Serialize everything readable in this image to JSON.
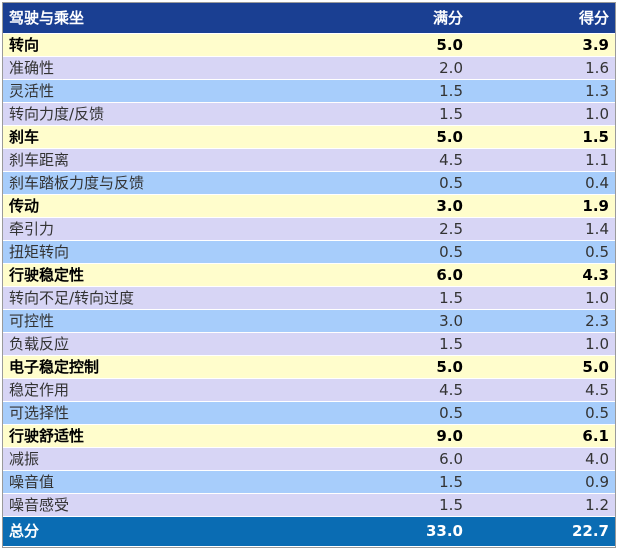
{
  "table": {
    "header": {
      "name": "驾驶与乘坐",
      "max": "满分",
      "score": "得分"
    },
    "rows": [
      {
        "type": "category",
        "name": "转向",
        "max": "5.0",
        "score": "3.9"
      },
      {
        "type": "sub",
        "name": "准确性",
        "max": "2.0",
        "score": "1.6"
      },
      {
        "type": "sub",
        "name": "灵活性",
        "max": "1.5",
        "score": "1.3"
      },
      {
        "type": "sub",
        "name": "转向力度/反馈",
        "max": "1.5",
        "score": "1.0"
      },
      {
        "type": "category",
        "name": "刹车",
        "max": "5.0",
        "score": "1.5"
      },
      {
        "type": "sub",
        "name": "刹车距离",
        "max": "4.5",
        "score": "1.1"
      },
      {
        "type": "sub",
        "name": "刹车踏板力度与反馈",
        "max": "0.5",
        "score": "0.4"
      },
      {
        "type": "category",
        "name": "传动",
        "max": "3.0",
        "score": "1.9"
      },
      {
        "type": "sub",
        "name": "牵引力",
        "max": "2.5",
        "score": "1.4"
      },
      {
        "type": "sub",
        "name": "扭矩转向",
        "max": "0.5",
        "score": "0.5"
      },
      {
        "type": "category",
        "name": "行驶稳定性",
        "max": "6.0",
        "score": "4.3"
      },
      {
        "type": "sub",
        "name": "转向不足/转向过度",
        "max": "1.5",
        "score": "1.0"
      },
      {
        "type": "sub",
        "name": "可控性",
        "max": "3.0",
        "score": "2.3"
      },
      {
        "type": "sub",
        "name": "负载反应",
        "max": "1.5",
        "score": "1.0"
      },
      {
        "type": "category",
        "name": "电子稳定控制",
        "max": "5.0",
        "score": "5.0"
      },
      {
        "type": "sub",
        "name": "稳定作用",
        "max": "4.5",
        "score": "4.5"
      },
      {
        "type": "sub",
        "name": "可选择性",
        "max": "0.5",
        "score": "0.5"
      },
      {
        "type": "category",
        "name": "行驶舒适性",
        "max": "9.0",
        "score": "6.1"
      },
      {
        "type": "sub",
        "name": "减振",
        "max": "6.0",
        "score": "4.0"
      },
      {
        "type": "sub",
        "name": "噪音值",
        "max": "1.5",
        "score": "0.9"
      },
      {
        "type": "sub",
        "name": "噪音感受",
        "max": "1.5",
        "score": "1.2"
      }
    ],
    "total": {
      "name": "总分",
      "max": "33.0",
      "score": "22.7"
    }
  },
  "colors": {
    "header_bg": "#1a3f92",
    "category_bg": "#fffdcc",
    "sub_a_bg": "#d7d5f5",
    "sub_b_bg": "#a7cdfb",
    "total_bg": "#0a6cb3"
  }
}
